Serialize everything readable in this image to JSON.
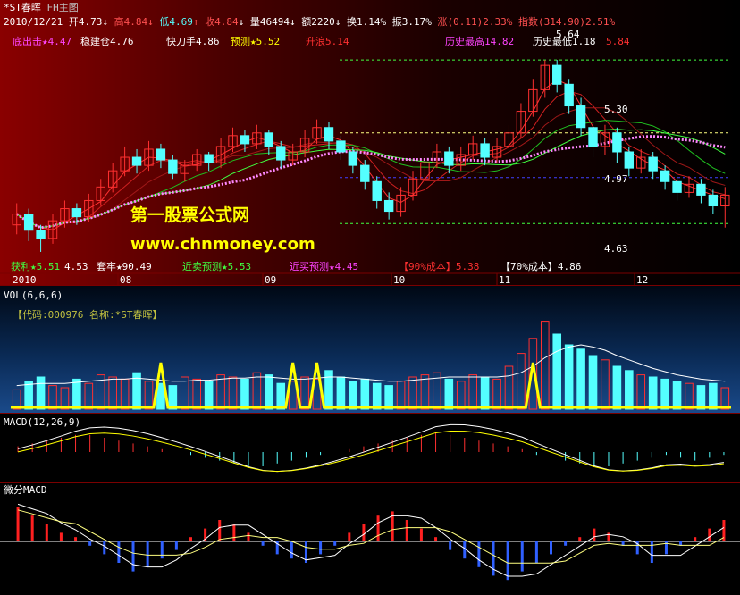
{
  "title_bar": {
    "name": "*ST春晖",
    "view": "FH主图"
  },
  "quote": {
    "date": "2010/12/21",
    "open": "开4.73",
    "high": "高4.84",
    "low": "低4.69",
    "close": "收4.84",
    "volume": "量46494",
    "amount": "额2220",
    "turnover": "换1.14%",
    "amplitude": "振3.17%",
    "change": "涨(0.11)2.33%",
    "index": "指数(314.90)2.51%",
    "arrow_down": "↓",
    "arrow_up": "↑"
  },
  "signals_top": {
    "s1": "底出击★4.47",
    "s2": "稳建仓4.76",
    "s3": "快刀手4.86",
    "s4": "预测★5.52",
    "s5": "升浪5.14",
    "s6": "历史最高14.82",
    "s7": "历史最低1.18",
    "s8": "5.84"
  },
  "price_levels": {
    "p1": "5.30",
    "p2": "4.97",
    "p3": "4.63",
    "p4": "5.64"
  },
  "signals_bottom": {
    "b1": "获利★5.51",
    "b1v": "4.53",
    "b2": "套牢★90.49",
    "b3": "近卖预测★5.53",
    "b4": "近买预测★4.45",
    "b5": "【90%成本】5.38",
    "b6": "【70%成本】4.86"
  },
  "x_axis": [
    "2010",
    "08",
    "09",
    "10",
    "11",
    "12"
  ],
  "watermark": {
    "line1": "第一股票公式网",
    "line2": "www.chnmoney.com"
  },
  "vol_panel": {
    "title": "VOL(6,6,6)",
    "info": "【代码:000976 名称:*ST春晖】"
  },
  "macd_panel": {
    "title": "MACD(12,26,9)"
  },
  "wmacd_panel": {
    "title": "微分MACD"
  },
  "colors": {
    "up": "#ff3030",
    "down": "#54ffff",
    "ma": "#ffffff",
    "highlight": "#ffff00",
    "magenta": "#ff44ff"
  },
  "chart_data": {
    "type": "candlestick",
    "symbol": "000976",
    "ylim": [
      4.4,
      5.9
    ],
    "note_levels": [
      5.84,
      5.3,
      4.97,
      4.63
    ],
    "candles": [
      {
        "o": 4.62,
        "c": 4.7,
        "h": 4.78,
        "l": 4.55
      },
      {
        "o": 4.7,
        "c": 4.58,
        "h": 4.74,
        "l": 4.5
      },
      {
        "o": 4.58,
        "c": 4.52,
        "h": 4.62,
        "l": 4.42
      },
      {
        "o": 4.52,
        "c": 4.65,
        "h": 4.7,
        "l": 4.48
      },
      {
        "o": 4.65,
        "c": 4.74,
        "h": 4.8,
        "l": 4.6
      },
      {
        "o": 4.74,
        "c": 4.68,
        "h": 4.78,
        "l": 4.62
      },
      {
        "o": 4.68,
        "c": 4.8,
        "h": 4.85,
        "l": 4.64
      },
      {
        "o": 4.8,
        "c": 4.9,
        "h": 4.96,
        "l": 4.76
      },
      {
        "o": 4.9,
        "c": 5.02,
        "h": 5.08,
        "l": 4.86
      },
      {
        "o": 5.02,
        "c": 5.12,
        "h": 5.2,
        "l": 4.98
      },
      {
        "o": 5.12,
        "c": 5.06,
        "h": 5.18,
        "l": 5.0
      },
      {
        "o": 5.06,
        "c": 5.18,
        "h": 5.24,
        "l": 5.02
      },
      {
        "o": 5.18,
        "c": 5.1,
        "h": 5.22,
        "l": 5.04
      },
      {
        "o": 5.1,
        "c": 5.0,
        "h": 5.14,
        "l": 4.96
      },
      {
        "o": 5.0,
        "c": 5.06,
        "h": 5.1,
        "l": 4.94
      },
      {
        "o": 5.06,
        "c": 5.14,
        "h": 5.18,
        "l": 5.02
      },
      {
        "o": 5.14,
        "c": 5.08,
        "h": 5.16,
        "l": 5.02
      },
      {
        "o": 5.08,
        "c": 5.2,
        "h": 5.26,
        "l": 5.04
      },
      {
        "o": 5.2,
        "c": 5.28,
        "h": 5.34,
        "l": 5.16
      },
      {
        "o": 5.28,
        "c": 5.22,
        "h": 5.32,
        "l": 5.16
      },
      {
        "o": 5.22,
        "c": 5.3,
        "h": 5.36,
        "l": 5.18
      },
      {
        "o": 5.3,
        "c": 5.2,
        "h": 5.32,
        "l": 5.14
      },
      {
        "o": 5.2,
        "c": 5.1,
        "h": 5.24,
        "l": 5.04
      },
      {
        "o": 5.1,
        "c": 5.16,
        "h": 5.22,
        "l": 5.06
      },
      {
        "o": 5.16,
        "c": 5.26,
        "h": 5.32,
        "l": 5.12
      },
      {
        "o": 5.26,
        "c": 5.34,
        "h": 5.4,
        "l": 5.22
      },
      {
        "o": 5.34,
        "c": 5.24,
        "h": 5.38,
        "l": 5.18
      },
      {
        "o": 5.24,
        "c": 5.16,
        "h": 5.28,
        "l": 5.1
      },
      {
        "o": 5.16,
        "c": 5.06,
        "h": 5.2,
        "l": 5.0
      },
      {
        "o": 5.06,
        "c": 4.94,
        "h": 5.1,
        "l": 4.88
      },
      {
        "o": 4.94,
        "c": 4.8,
        "h": 4.98,
        "l": 4.74
      },
      {
        "o": 4.8,
        "c": 4.72,
        "h": 4.86,
        "l": 4.66
      },
      {
        "o": 4.72,
        "c": 4.84,
        "h": 4.9,
        "l": 4.68
      },
      {
        "o": 4.84,
        "c": 4.96,
        "h": 5.02,
        "l": 4.8
      },
      {
        "o": 4.96,
        "c": 5.08,
        "h": 5.14,
        "l": 4.92
      },
      {
        "o": 5.08,
        "c": 5.16,
        "h": 5.22,
        "l": 5.04
      },
      {
        "o": 5.16,
        "c": 5.06,
        "h": 5.2,
        "l": 5.0
      },
      {
        "o": 5.06,
        "c": 5.14,
        "h": 5.2,
        "l": 5.02
      },
      {
        "o": 5.14,
        "c": 5.22,
        "h": 5.28,
        "l": 5.1
      },
      {
        "o": 5.22,
        "c": 5.12,
        "h": 5.26,
        "l": 5.06
      },
      {
        "o": 5.12,
        "c": 5.2,
        "h": 5.26,
        "l": 5.08
      },
      {
        "o": 5.2,
        "c": 5.3,
        "h": 5.36,
        "l": 5.16
      },
      {
        "o": 5.3,
        "c": 5.46,
        "h": 5.52,
        "l": 5.26
      },
      {
        "o": 5.46,
        "c": 5.62,
        "h": 5.7,
        "l": 5.42
      },
      {
        "o": 5.62,
        "c": 5.8,
        "h": 5.84,
        "l": 5.56
      },
      {
        "o": 5.8,
        "c": 5.66,
        "h": 5.84,
        "l": 5.6
      },
      {
        "o": 5.66,
        "c": 5.5,
        "h": 5.7,
        "l": 5.44
      },
      {
        "o": 5.5,
        "c": 5.34,
        "h": 5.56,
        "l": 5.28
      },
      {
        "o": 5.34,
        "c": 5.2,
        "h": 5.38,
        "l": 5.12
      },
      {
        "o": 5.2,
        "c": 5.3,
        "h": 5.36,
        "l": 5.14
      },
      {
        "o": 5.3,
        "c": 5.16,
        "h": 5.34,
        "l": 5.08
      },
      {
        "o": 5.16,
        "c": 5.04,
        "h": 5.2,
        "l": 4.98
      },
      {
        "o": 5.04,
        "c": 5.12,
        "h": 5.18,
        "l": 5.0
      },
      {
        "o": 5.12,
        "c": 5.02,
        "h": 5.16,
        "l": 4.96
      },
      {
        "o": 5.02,
        "c": 4.94,
        "h": 5.06,
        "l": 4.88
      },
      {
        "o": 4.94,
        "c": 4.86,
        "h": 4.98,
        "l": 4.8
      },
      {
        "o": 4.86,
        "c": 4.92,
        "h": 4.98,
        "l": 4.82
      },
      {
        "o": 4.92,
        "c": 4.84,
        "h": 4.96,
        "l": 4.78
      },
      {
        "o": 4.84,
        "c": 4.76,
        "h": 4.88,
        "l": 4.7
      },
      {
        "o": 4.76,
        "c": 4.84,
        "h": 4.9,
        "l": 4.6
      }
    ],
    "volume": [
      18,
      26,
      30,
      22,
      20,
      28,
      24,
      32,
      30,
      28,
      34,
      26,
      24,
      22,
      30,
      28,
      26,
      32,
      30,
      28,
      34,
      32,
      24,
      26,
      30,
      28,
      36,
      30,
      26,
      28,
      24,
      22,
      26,
      30,
      32,
      34,
      28,
      26,
      32,
      30,
      28,
      40,
      52,
      66,
      82,
      70,
      60,
      56,
      50,
      46,
      40,
      36,
      32,
      30,
      28,
      26,
      24,
      22,
      24,
      20
    ],
    "vol_ma": [
      22,
      23,
      24,
      24,
      24,
      25,
      26,
      27,
      28,
      28,
      29,
      28,
      27,
      26,
      26,
      27,
      27,
      28,
      29,
      29,
      30,
      30,
      29,
      28,
      28,
      29,
      30,
      30,
      29,
      28,
      27,
      26,
      26,
      27,
      28,
      29,
      30,
      30,
      30,
      30,
      30,
      31,
      34,
      40,
      48,
      54,
      58,
      60,
      58,
      55,
      50,
      46,
      42,
      38,
      35,
      32,
      30,
      28,
      27,
      26
    ],
    "vol_highlight_peaks": [
      12,
      23,
      25,
      43
    ],
    "macd_hist": [
      0.02,
      0.03,
      0.04,
      0.05,
      0.06,
      0.06,
      0.05,
      0.04,
      0.03,
      0.02,
      0.01,
      0.0,
      -0.01,
      -0.02,
      -0.03,
      -0.04,
      -0.05,
      -0.05,
      -0.04,
      -0.03,
      -0.02,
      -0.01,
      0.0,
      0.01,
      0.02,
      0.03,
      0.04,
      0.05,
      0.06,
      0.07,
      0.06,
      0.05,
      0.04,
      0.03,
      0.02,
      0.01,
      -0.01,
      -0.02,
      -0.03,
      -0.04,
      -0.05,
      -0.05,
      -0.04,
      -0.03,
      -0.02,
      -0.01,
      -0.02,
      -0.03,
      -0.02,
      -0.01
    ],
    "wmacd_hist": [
      0.8,
      0.6,
      0.4,
      0.2,
      0.1,
      -0.1,
      -0.3,
      -0.5,
      -0.7,
      -0.6,
      -0.4,
      -0.2,
      0.1,
      0.3,
      0.5,
      0.4,
      0.2,
      -0.1,
      -0.3,
      -0.4,
      -0.5,
      -0.3,
      -0.1,
      0.2,
      0.4,
      0.6,
      0.7,
      0.5,
      0.3,
      0.1,
      -0.2,
      -0.4,
      -0.6,
      -0.8,
      -0.9,
      -0.7,
      -0.5,
      -0.3,
      -0.1,
      0.1,
      0.3,
      0.2,
      -0.1,
      -0.3,
      -0.5,
      -0.3,
      -0.1,
      0.1,
      0.3,
      0.5
    ]
  }
}
